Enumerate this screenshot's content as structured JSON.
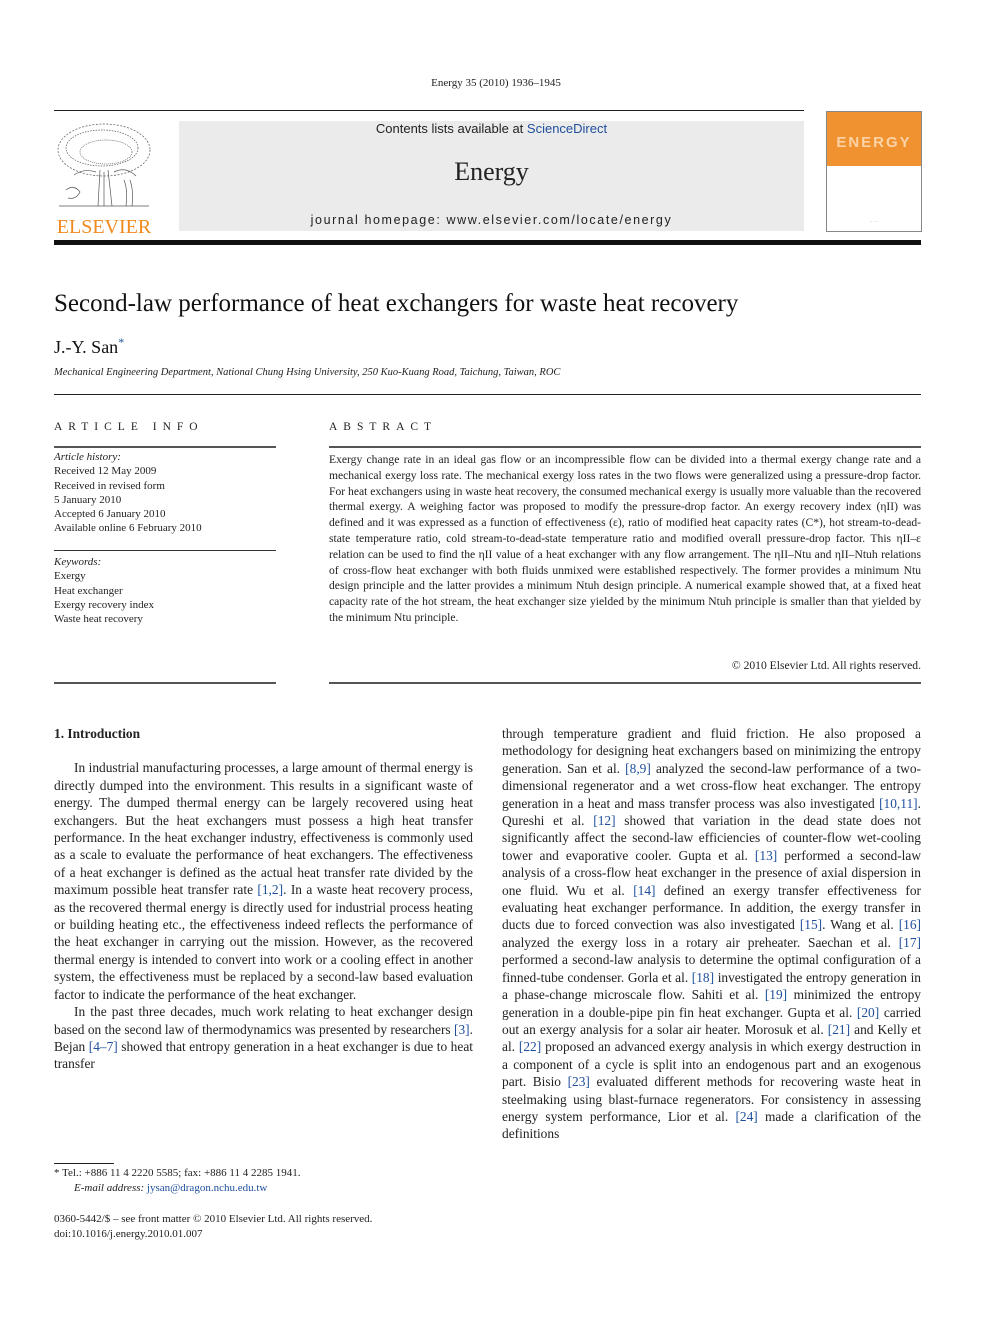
{
  "running_head": "Energy 35 (2010) 1936–1945",
  "header": {
    "publisher_logo_icon": "elsevier-tree-logo",
    "publisher_name": "ELSEVIER",
    "contents_prefix": "Contents lists available at ",
    "contents_link": "ScienceDirect",
    "journal_name": "Energy",
    "homepage": "journal homepage: www.elsevier.com/locate/energy",
    "cover_title": "ENERGY",
    "cover_icon": "journal-cover-thumbnail"
  },
  "article": {
    "title": "Second-law performance of heat exchangers for waste heat recovery",
    "author": "J.-Y. San",
    "author_mark": "*",
    "affiliation": "Mechanical Engineering Department, National Chung Hsing University, 250 Kuo-Kuang Road, Taichung, Taiwan, ROC"
  },
  "article_info": {
    "heading": "ARTICLE INFO",
    "history_label": "Article history:",
    "history": [
      "Received 12 May 2009",
      "Received in revised form",
      "5 January 2010",
      "Accepted 6 January 2010",
      "Available online 6 February 2010"
    ],
    "keywords_label": "Keywords:",
    "keywords": [
      "Exergy",
      "Heat exchanger",
      "Exergy recovery index",
      "Waste heat recovery"
    ]
  },
  "abstract": {
    "heading": "ABSTRACT",
    "text": "Exergy change rate in an ideal gas flow or an incompressible flow can be divided into a thermal exergy change rate and a mechanical exergy loss rate. The mechanical exergy loss rates in the two flows were generalized using a pressure-drop factor. For heat exchangers using in waste heat recovery, the consumed mechanical exergy is usually more valuable than the recovered thermal exergy. A weighing factor was proposed to modify the pressure-drop factor. An exergy recovery index (ηII) was defined and it was expressed as a function of effectiveness (ε), ratio of modified heat capacity rates (C*), hot stream-to-dead-state temperature ratio, cold stream-to-dead-state temperature ratio and modified overall pressure-drop factor. This ηII–ε relation can be used to find the ηII value of a heat exchanger with any flow arrangement. The ηII–Ntu and ηII–Ntuh relations of cross-flow heat exchanger with both fluids unmixed were established respectively. The former provides a minimum Ntu design principle and the latter provides a minimum Ntuh design principle. A numerical example showed that, at a fixed heat capacity rate of the hot stream, the heat exchanger size yielded by the minimum Ntuh principle is smaller than that yielded by the minimum Ntu principle.",
    "copyright": "© 2010 Elsevier Ltd. All rights reserved."
  },
  "body": {
    "section_heading": "1.  Introduction",
    "left_p1_a": "In industrial manufacturing processes, a large amount of thermal energy is directly dumped into the environment. This results in a significant waste of energy. The dumped thermal energy can be largely recovered using heat exchangers. But the heat exchangers must possess a high heat transfer performance. In the heat exchanger industry, effectiveness is commonly used as a scale to evaluate the performance of heat exchangers. The effectiveness of a heat exchanger is defined as the actual heat transfer rate divided by the maximum possible heat transfer rate ",
    "ref_1_2": "[1,2]",
    "left_p1_b": ". In a waste heat recovery process, as the recovered thermal energy is directly used for industrial process heating or building heating etc., the effectiveness indeed reflects the performance of the heat exchanger in carrying out the mission. However, as the recovered thermal energy is intended to convert into work or a cooling effect in another system, the effectiveness must be replaced by a second-law based evaluation factor to indicate the performance of the heat exchanger.",
    "left_p2_a": "In the past three decades, much work relating to heat exchanger design based on the second law of thermodynamics was presented by researchers ",
    "ref_3": "[3]",
    "left_p2_b": ". Bejan ",
    "ref_4_7": "[4–7]",
    "left_p2_c": " showed that entropy generation in a heat exchanger is due to heat transfer",
    "right": [
      {
        "t": "through temperature gradient and fluid friction. He also proposed a methodology for designing heat exchangers based on minimizing the entropy generation. San et al. "
      },
      {
        "r": "[8,9]"
      },
      {
        "t": " analyzed the second-law performance of a two-dimensional regenerator and a wet cross-flow heat exchanger. The entropy generation in a heat and mass transfer process was also investigated "
      },
      {
        "r": "[10,11]"
      },
      {
        "t": ". Qureshi et al. "
      },
      {
        "r": "[12]"
      },
      {
        "t": " showed that variation in the dead state does not significantly affect the second-law efficiencies of counter-flow wet-cooling tower and evaporative cooler. Gupta et al. "
      },
      {
        "r": "[13]"
      },
      {
        "t": " performed a second-law analysis of a cross-flow heat exchanger in the presence of axial dispersion in one fluid. Wu et al. "
      },
      {
        "r": "[14]"
      },
      {
        "t": " defined an exergy transfer effectiveness for evaluating heat exchanger performance. In addition, the exergy transfer in ducts due to forced convection was also investigated "
      },
      {
        "r": "[15]"
      },
      {
        "t": ". Wang et al. "
      },
      {
        "r": "[16]"
      },
      {
        "t": " analyzed the exergy loss in a rotary air preheater. Saechan et al. "
      },
      {
        "r": "[17]"
      },
      {
        "t": " performed a second-law analysis to determine the optimal configuration of a finned-tube condenser. Gorla et al. "
      },
      {
        "r": "[18]"
      },
      {
        "t": " investigated the entropy generation in a phase-change microscale flow. Sahiti et al. "
      },
      {
        "r": "[19]"
      },
      {
        "t": " minimized the entropy generation in a double-pipe pin fin heat exchanger. Gupta et al. "
      },
      {
        "r": "[20]"
      },
      {
        "t": " carried out an exergy analysis for a solar air heater. Morosuk et al. "
      },
      {
        "r": "[21]"
      },
      {
        "t": " and Kelly et al. "
      },
      {
        "r": "[22]"
      },
      {
        "t": " proposed an advanced exergy analysis in which exergy destruction in a component of a cycle is split into an endogenous part and an exogenous part. Bisio "
      },
      {
        "r": "[23]"
      },
      {
        "t": " evaluated different methods for recovering waste heat in steelmaking using blast-furnace regenerators. For consistency in assessing energy system performance, Lior et al. "
      },
      {
        "r": "[24]"
      },
      {
        "t": " made a clarification of the definitions"
      }
    ]
  },
  "footnote": {
    "contact": "*  Tel.: +886 11 4 2220 5585; fax: +886 11 4 2285 1941.",
    "email_label": "E-mail address: ",
    "email": "jysan@dragon.nchu.edu.tw"
  },
  "front_matter": {
    "issn_line": "0360-5442/$ – see front matter © 2010 Elsevier Ltd. All rights reserved.",
    "doi": "doi:10.1016/j.energy.2010.01.007"
  },
  "colors": {
    "link": "#1f4f9c",
    "elsevier_orange": "#f08a1e",
    "banner_gray": "#ebebeb",
    "cover_orange": "#f0922f"
  }
}
